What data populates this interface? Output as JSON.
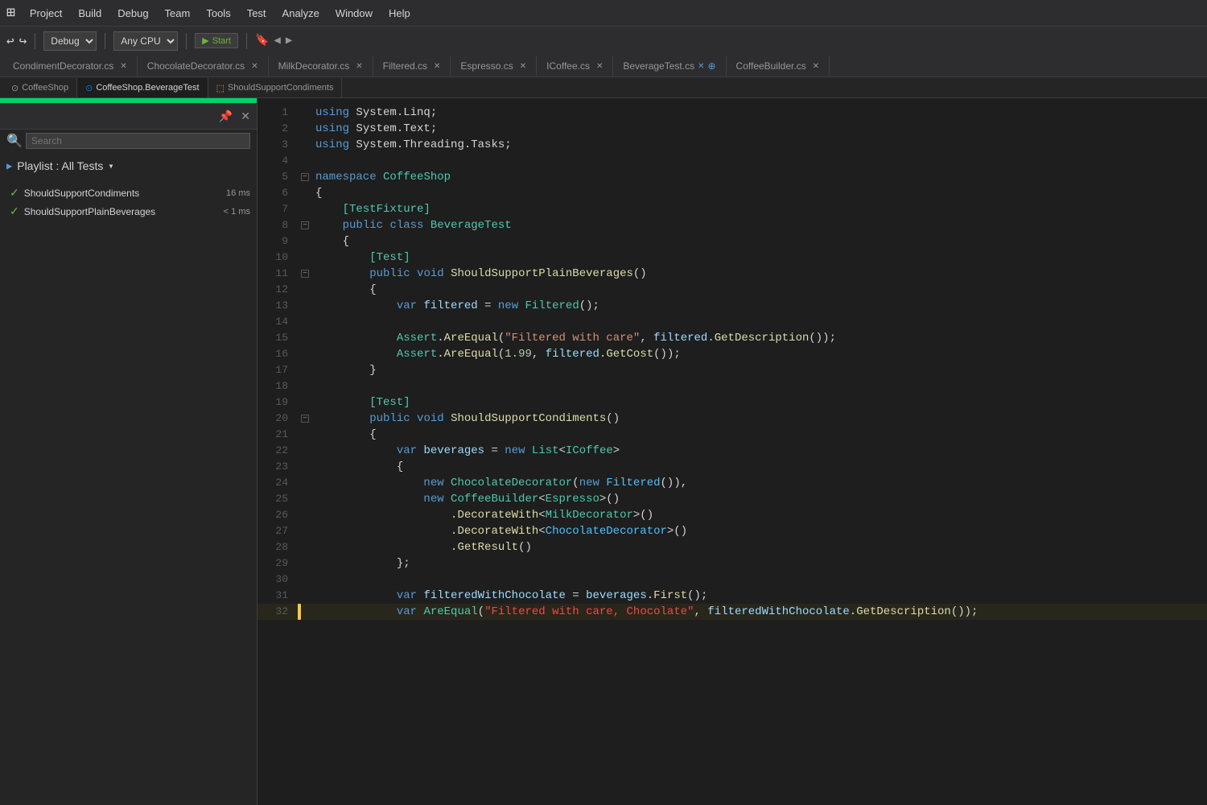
{
  "menubar": {
    "items": [
      "Project",
      "Build",
      "Debug",
      "Team",
      "Tools",
      "Test",
      "Analyze",
      "Window",
      "Help"
    ]
  },
  "toolbar": {
    "config_label": "Debug",
    "platform_label": "Any CPU",
    "play_label": "Start",
    "start_icon": "▶"
  },
  "tabs_row1": {
    "tabs": [
      {
        "label": "CondimentDecorator.cs",
        "active": false
      },
      {
        "label": "ChocolateDecorator.cs",
        "active": false
      },
      {
        "label": "MilkDecorator.cs",
        "active": false
      },
      {
        "label": "Filtered.cs",
        "active": false
      },
      {
        "label": "Espresso.cs",
        "active": false
      },
      {
        "label": "ICoffee.cs",
        "active": false
      },
      {
        "label": "BeverageTest.cs",
        "active": false
      },
      {
        "label": "CoffeeBuilder.cs",
        "active": false
      }
    ]
  },
  "tabs_row2": {
    "tabs": [
      {
        "label": "CoffeeShop",
        "active": false
      },
      {
        "label": "CoffeeShop.BeverageTest",
        "active": true,
        "has_dot": true
      },
      {
        "label": "ShouldSupportCondiments",
        "active": false
      }
    ]
  },
  "left_panel": {
    "playlist_label": "Playlist : All Tests",
    "dropdown_icon": "▾",
    "tests": [
      {
        "name": "ShouldSupportCondiments",
        "time": "16 ms",
        "passed": true
      },
      {
        "name": "ShouldSupportPlainBeverages",
        "time": "< 1 ms",
        "passed": true
      }
    ]
  },
  "code": {
    "using_lines": [
      "using System.Linq;",
      "using System.Text;",
      "using System.Threading.Tasks;"
    ],
    "namespace": "CoffeeShop",
    "class_attr": "[TestFixture]",
    "class_decl": "public class BeverageTest",
    "method1_attr": "[Test]",
    "method1_decl": "public void ShouldSupportPlainBeverages()",
    "method1_body": [
      "var filtered = new Filtered();",
      "",
      "Assert.AreEqual(\"Filtered with care\", filtered.GetDescription());",
      "Assert.AreEqual(1.99, filtered.GetCost());"
    ],
    "method2_attr": "[Test]",
    "method2_decl": "public void ShouldSupportCondiments()",
    "method2_body": [
      "var beverages = new List<ICoffee>",
      "{",
      "    new ChocolateDecorator(new Filtered()),",
      "    new CoffeeBuilder<Espresso>()",
      "        .DecorateWith<MilkDecorator>()",
      "        .DecorateWith<ChocolateDecorator>()",
      "        .GetResult()",
      "};"
    ],
    "method2_cont": [
      "var filteredWithChocolate = beverages.First();",
      "var AreEqual(\"Filtered with care, Chocolate\", filteredWithChocolate.GetDescription());"
    ]
  }
}
